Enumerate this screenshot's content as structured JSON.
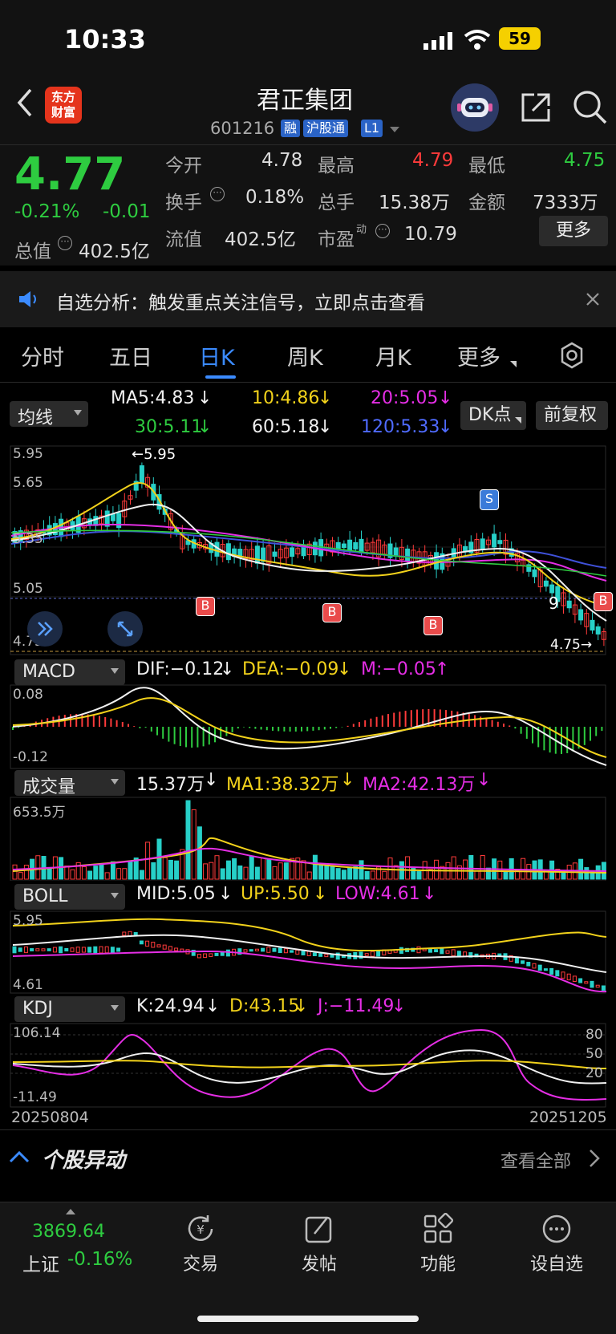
{
  "status": {
    "time": "10:33",
    "battery": "59"
  },
  "header": {
    "logo_line1": "东方",
    "logo_line2": "财富",
    "title": "君正集团",
    "code": "601216",
    "tags": [
      "融",
      "沪股通",
      "L1"
    ]
  },
  "quote": {
    "price": "4.77",
    "pct": "-0.21%",
    "chg": "-0.01",
    "labels": {
      "open": "今开",
      "high": "最高",
      "low": "最低",
      "turnover": "换手",
      "volume": "总手",
      "amount": "金额",
      "total_cap": "总值",
      "float_cap": "流值",
      "pe": "市盈",
      "pe_sup": "动"
    },
    "open": "4.78",
    "high": "4.79",
    "low": "4.75",
    "turnover": "0.18%",
    "volume": "15.38万",
    "amount": "7333万",
    "total_cap": "402.5亿",
    "float_cap": "402.5亿",
    "pe": "10.79",
    "more": "更多"
  },
  "notice": {
    "text": "自选分析：触发重点关注信号，立即点击查看"
  },
  "tabs": [
    "分时",
    "五日",
    "日K",
    "周K",
    "月K",
    "更多"
  ],
  "active_tab": "日K",
  "ma": {
    "selector": "均线",
    "ma5": "MA5:4.83",
    "ma10": "10:4.86",
    "ma20": "20:5.05",
    "ma30": "30:5.11",
    "ma60": "60:5.18",
    "ma120": "120:5.33",
    "dk": "DK点",
    "fq": "前复权"
  },
  "kline": {
    "y_top": "5.95",
    "y_mid1": "5.65",
    "y_mid2": "5.35",
    "y_mid3": "5.05",
    "y_low": "4.75",
    "peak_label": "5.95",
    "low_label": "4.75",
    "buy_label": "B",
    "sell_label": "S",
    "count_label": "9"
  },
  "macd": {
    "selector": "MACD",
    "dif": "DIF:−0.12",
    "dea": "DEA:−0.09",
    "m": "M:−0.05",
    "y_top": "0.08",
    "y_bot": "-0.12"
  },
  "vol": {
    "selector": "成交量",
    "v": "15.37万",
    "ma1": "MA1:38.32万",
    "ma2": "MA2:42.13万",
    "y_top": "653.5万"
  },
  "boll": {
    "selector": "BOLL",
    "mid": "MID:5.05",
    "up": "UP:5.50",
    "low": "LOW:4.61",
    "y_top": "5.95",
    "y_bot": "4.61"
  },
  "kdj": {
    "selector": "KDJ",
    "k": "K:24.94",
    "d": "D:43.15",
    "j": "J:−11.49",
    "y_top": "106.14",
    "y_bot": "-11.49",
    "r80": "80",
    "r50": "50",
    "r20": "20",
    "date_start": "20250804",
    "date_end": "20251205"
  },
  "movers": {
    "title": "个股异动",
    "view_all": "查看全部"
  },
  "bottom": {
    "index_value": "3869.64",
    "index_name": "上证",
    "index_pct": "-0.16%",
    "nav": [
      "交易",
      "发帖",
      "功能",
      "设自选"
    ]
  },
  "colors": {
    "up": "#ff3b3b",
    "down": "#2ecc40",
    "accent": "#3b8bff",
    "yellow": "#f2d21b",
    "magenta": "#e52ee5",
    "blue": "#3f51d9",
    "white": "#f0f0f0"
  }
}
